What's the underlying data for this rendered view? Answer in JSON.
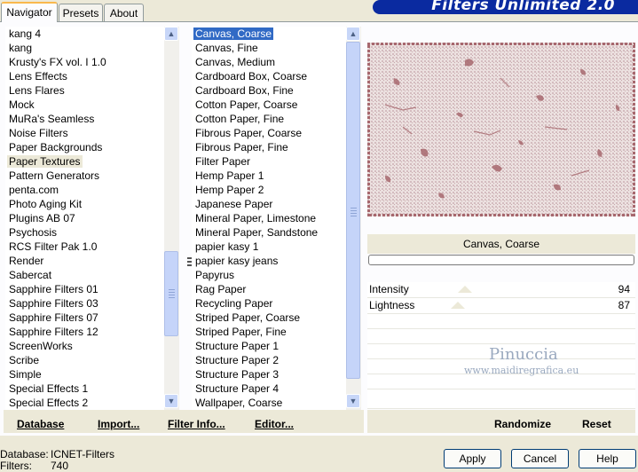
{
  "tabs": [
    "Navigator",
    "Presets",
    "About"
  ],
  "app_title": "Filters Unlimited 2.0",
  "categories": [
    "kang 4",
    "kang",
    "Krusty's FX vol. I 1.0",
    "Lens Effects",
    "Lens Flares",
    "Mock",
    "MuRa's Seamless",
    "Noise Filters",
    "Paper Backgrounds",
    "Paper Textures",
    "Pattern Generators",
    "penta.com",
    "Photo Aging Kit",
    "Plugins AB 07",
    "Psychosis",
    "RCS Filter Pak 1.0",
    "Render",
    "Sabercat",
    "Sapphire Filters 01",
    "Sapphire Filters 03",
    "Sapphire Filters 07",
    "Sapphire Filters 12",
    "ScreenWorks",
    "Scribe",
    "Simple",
    "Special Effects 1",
    "Special Effects 2"
  ],
  "selected_category": "Paper Textures",
  "filters": [
    "Canvas, Coarse",
    "Canvas, Fine",
    "Canvas, Medium",
    "Cardboard Box, Coarse",
    "Cardboard Box, Fine",
    "Cotton Paper, Coarse",
    "Cotton Paper, Fine",
    "Fibrous Paper, Coarse",
    "Fibrous Paper, Fine",
    "Filter Paper",
    "Hemp Paper 1",
    "Hemp Paper 2",
    "Japanese Paper",
    "Mineral Paper, Limestone",
    "Mineral Paper, Sandstone",
    "papier kasy 1",
    "papier kasy jeans",
    "Papyrus",
    "Rag Paper",
    "Recycling Paper",
    "Striped Paper, Coarse",
    "Striped Paper, Fine",
    "Structure Paper 1",
    "Structure Paper 2",
    "Structure Paper 3",
    "Structure Paper 4",
    "Wallpaper, Coarse"
  ],
  "selected_filter": "Canvas, Coarse",
  "filter_name_display": "Canvas, Coarse",
  "sliders": [
    {
      "label": "Intensity",
      "value": "94",
      "level": 94
    },
    {
      "label": "Lightness",
      "value": "87",
      "level": 87
    }
  ],
  "watermark": {
    "line1": "Pinuccia",
    "line2": "www.maidiregrafica.eu"
  },
  "toolbar": {
    "database": "Database",
    "import": "Import...",
    "filter_info": "Filter Info...",
    "editor": "Editor...",
    "randomize": "Randomize",
    "reset": "Reset"
  },
  "status": {
    "database_label": "Database:",
    "database_value": "ICNET-Filters",
    "filters_label": "Filters:",
    "filters_value": "740"
  },
  "buttons": {
    "apply": "Apply",
    "cancel": "Cancel",
    "help": "Help"
  },
  "colors": {
    "selection_blue": "#316ac5",
    "banner_blue": "#0a2aa0",
    "texture": "#a8696e"
  }
}
